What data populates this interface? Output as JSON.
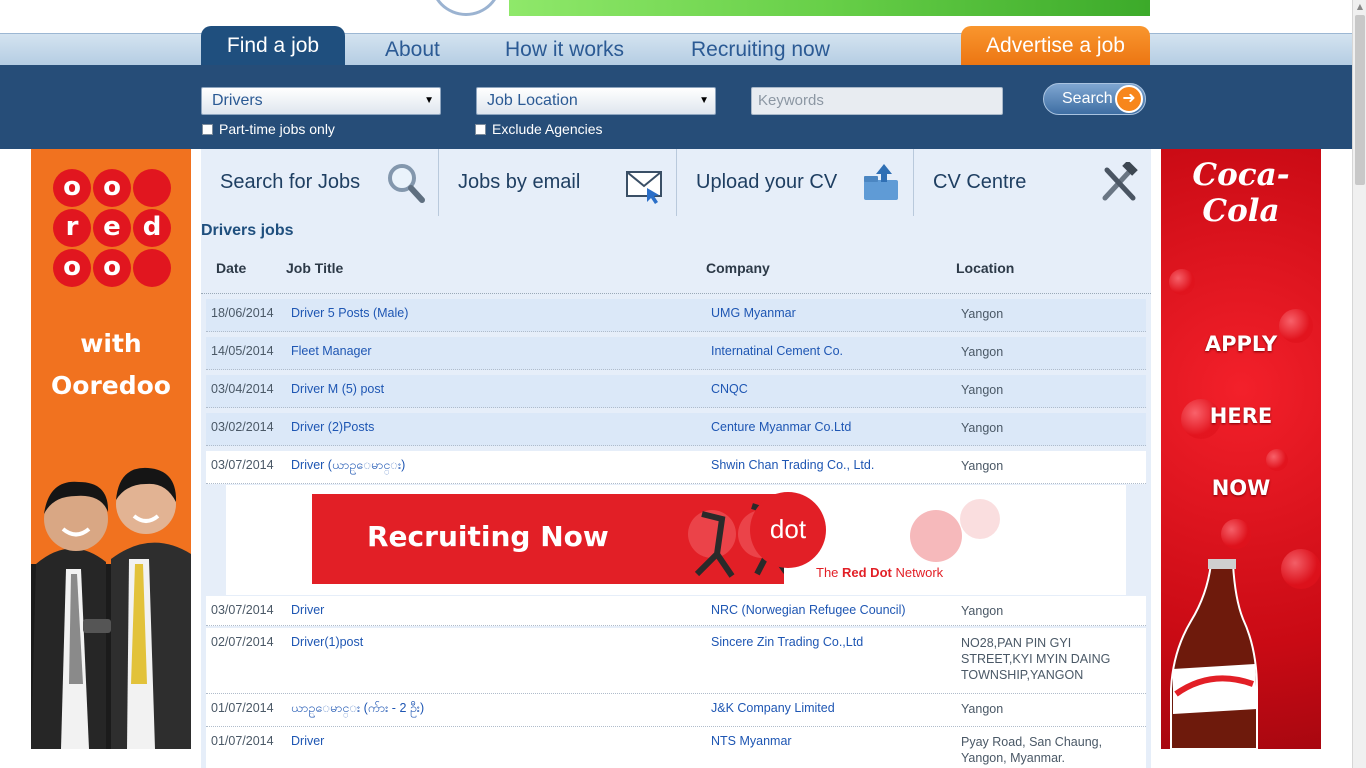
{
  "nav": {
    "find": "Find a job",
    "about": "About",
    "how": "How it works",
    "recruiting": "Recruiting now",
    "advertise": "Advertise a job"
  },
  "search": {
    "category": "Drivers",
    "location": "Job Location",
    "keywords_placeholder": "Keywords",
    "button": "Search",
    "parttime": "Part-time jobs only",
    "agencies": "Exclude Agencies"
  },
  "features": [
    {
      "label": "Search for Jobs",
      "icon": "magnifier-icon"
    },
    {
      "label": "Jobs by email",
      "icon": "envelope-icon"
    },
    {
      "label": "Upload your CV",
      "icon": "folder-upload-icon"
    },
    {
      "label": "CV Centre",
      "icon": "tools-icon"
    }
  ],
  "jobs": {
    "heading": "Drivers jobs",
    "columns": {
      "date": "Date",
      "title": "Job Title",
      "company": "Company",
      "location": "Location"
    },
    "rows": [
      {
        "date": "18/06/2014",
        "title": "Driver 5 Posts (Male)",
        "company": "UMG Myanmar",
        "location": "Yangon"
      },
      {
        "date": "14/05/2014",
        "title": "Fleet Manager",
        "company": "Internatinal Cement Co.",
        "location": "Yangon"
      },
      {
        "date": "03/04/2014",
        "title": "Driver M (5) post",
        "company": "CNQC",
        "location": "Yangon"
      },
      {
        "date": "03/02/2014",
        "title": "Driver (2)Posts",
        "company": "Centure Myanmar Co.Ltd",
        "location": "Yangon"
      },
      {
        "date": "03/07/2014",
        "title": "Driver (ယာဥ္ေမာင္း)",
        "company": "Shwin Chan Trading Co., Ltd.",
        "location": "Yangon"
      },
      {
        "date": "03/07/2014",
        "title": "Driver",
        "company": "NRC (Norwegian Refugee Council)",
        "location": "Yangon"
      },
      {
        "date": "02/07/2014",
        "title": "Driver(1)post",
        "company": "Sincere Zin Trading Co.,Ltd",
        "location": "NO28,PAN PIN GYI STREET,KYI MYIN DAING TOWNSHIP,YANGON"
      },
      {
        "date": "01/07/2014",
        "title": "ယာဥ္ေမာင္း (က်ား - 2 ဦး)",
        "company": "J&K Company Limited",
        "location": "Yangon"
      },
      {
        "date": "01/07/2014",
        "title": "Driver",
        "company": "NTS Myanmar",
        "location": "Pyay Road, San Chaung, Yangon, Myanmar."
      }
    ]
  },
  "banner": {
    "headline": "Recruiting Now",
    "dot": "dot",
    "network_prefix": "The ",
    "network_bold": "Red Dot",
    "network_suffix": " Network"
  },
  "ad_left": {
    "dots": [
      "o",
      "o",
      "r",
      "e",
      "d",
      "o",
      "o"
    ],
    "with": "with",
    "brand": "Ooredoo"
  },
  "ad_right": {
    "brand": "Coca-Cola",
    "line1": "APPLY",
    "line2": "HERE",
    "line3": "NOW"
  },
  "colors": {
    "nav_dark": "#1f4f7e",
    "advertise": "#ec7512",
    "search_band": "#264d78",
    "link": "#1e56b3",
    "ooredoo": "#f1721f",
    "coke": "#e21f26"
  }
}
